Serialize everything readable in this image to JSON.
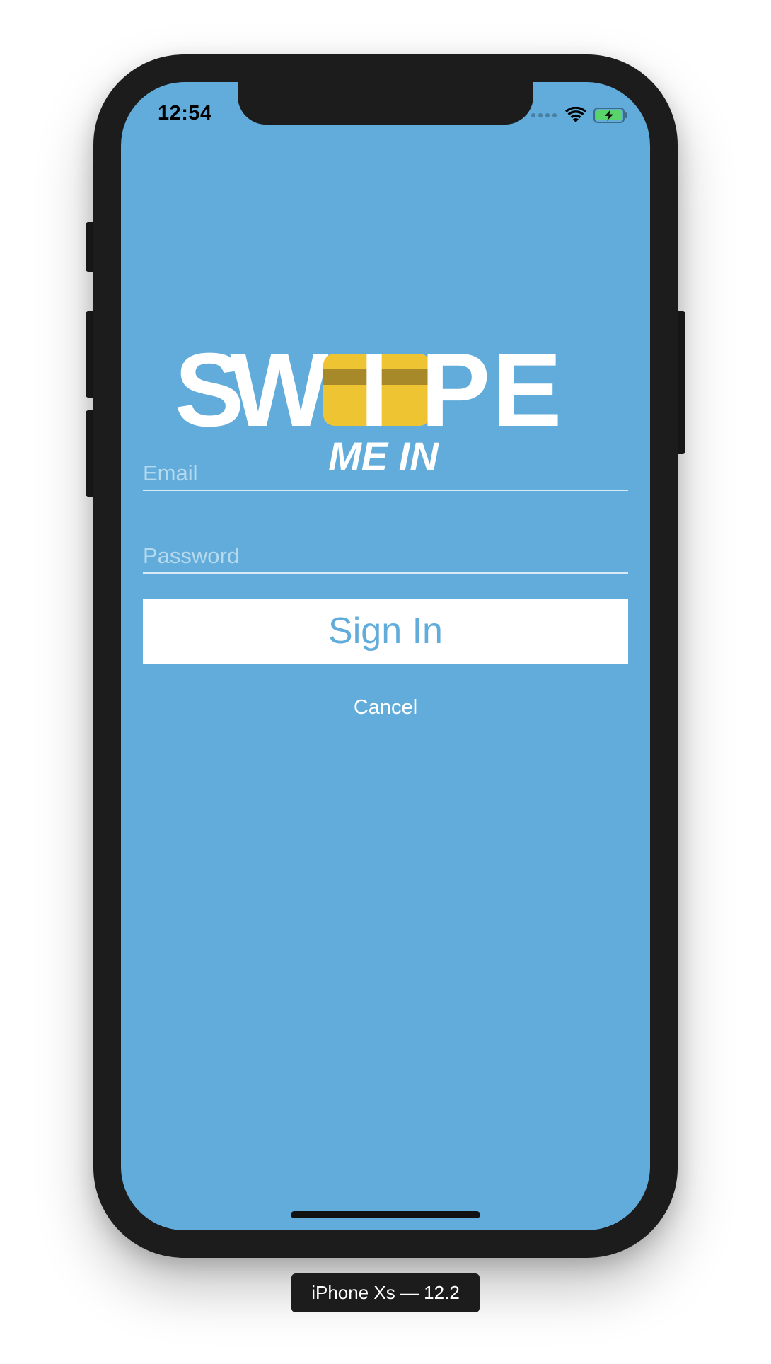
{
  "status_bar": {
    "time": "12:54",
    "icons": [
      "cellular-signal-icon",
      "wifi-icon",
      "battery-charging-icon"
    ]
  },
  "logo": {
    "word": "SWIPE",
    "letters": [
      "S",
      "W",
      "I",
      "P",
      "E"
    ],
    "tagline": "ME IN",
    "icon": "credit-card-icon"
  },
  "form": {
    "email_placeholder": "Email",
    "password_placeholder": "Password",
    "email_value": "",
    "password_value": "",
    "sign_in_label": "Sign In",
    "cancel_label": "Cancel"
  },
  "simulator": {
    "device_label": "iPhone Xs — 12.2"
  },
  "colors": {
    "background": "#61acda",
    "button_bg": "#ffffff",
    "button_text": "#61acda",
    "card_yellow": "#efc432",
    "card_stripe": "#a8892a",
    "bezel": "#1c1c1d"
  }
}
